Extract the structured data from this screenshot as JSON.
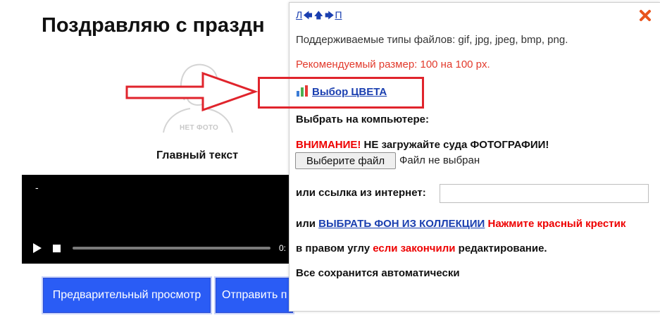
{
  "page": {
    "title": "Поздравляю с праздн",
    "no_photo_label": "НЕТ ФОТО",
    "main_text": "Главный текст",
    "video": {
      "caption": "-",
      "time": "0:"
    },
    "buttons": {
      "preview": "Предварительный просмотр",
      "send": "Отправить п"
    }
  },
  "panel": {
    "nav": {
      "left": "Л",
      "right": "П"
    },
    "supported_types": "Поддерживаемые типы файлов: gif, jpg, jpeg, bmp, png.",
    "recommended_size": "Рекомендуемый размер: 100 на 100 px.",
    "color_link": "Выбор ЦВЕТА",
    "pick_on_computer": "Выбрать на компьютере:",
    "warning_label": "ВНИМАНИЕ!",
    "warning_text": " НЕ загружайте суда ФОТОГРАФИИ!",
    "file_button": "Выберите файл",
    "file_status": "Файл не выбран",
    "link_label": "или ссылка из интернет:",
    "url_value": "",
    "bg_prefix": "или ",
    "bg_link": "ВЫБРАТЬ ФОН ИЗ КОЛЛЕКЦИИ",
    "bg_hint": " Нажмите красный крестик",
    "corner_prefix": "в правом углу ",
    "corner_red": "если закончили",
    "corner_suffix": " редактирование.",
    "autosave": "Все сохранится автоматически"
  },
  "colors": {
    "link": "#1a3fb0",
    "warning": "#e00000",
    "recommended": "#e23a2c",
    "button": "#2a5cf5",
    "annotation": "#e0242c"
  },
  "icons": [
    "close-icon",
    "arrow-left-icon",
    "arrow-up-icon",
    "arrow-right-icon",
    "chart-icon",
    "play-icon",
    "stop-icon",
    "no-photo-icon"
  ]
}
